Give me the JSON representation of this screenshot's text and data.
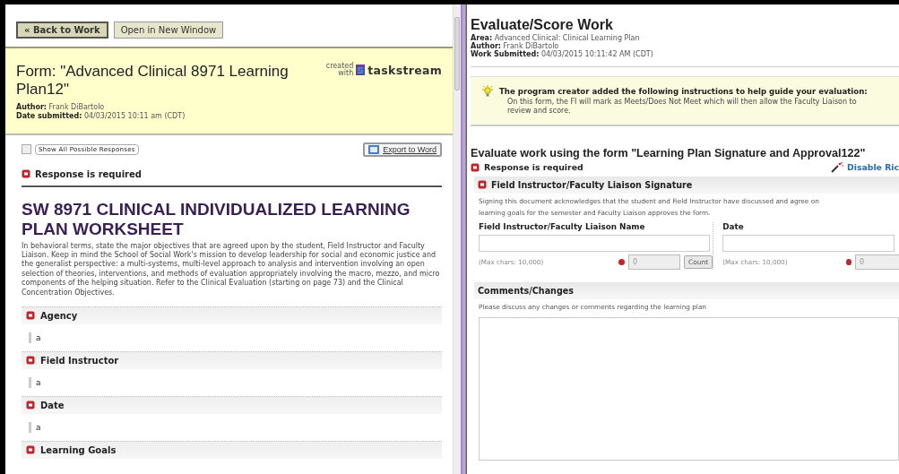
{
  "left": {
    "buttons": [
      {
        "label": "« Back to Work",
        "kind": "primary"
      },
      {
        "label": "Open in New Window",
        "kind": "secondary"
      }
    ],
    "form_header": {
      "title_label": "Form:",
      "title": "\"Advanced Clinical 8971 Learning Plan12\"",
      "created_with": "created with",
      "brand": "taskstream",
      "meta": [
        {
          "label": "Author:",
          "value": "Frank DiBartolo"
        },
        {
          "label": "Date submitted:",
          "value": "04/03/2015 10:11 am (CDT)"
        }
      ]
    },
    "show_all": {
      "label": "Show All Possible Responses",
      "checked": false
    },
    "export_button": "Export to Word",
    "required_note": "Response is required",
    "worksheet_title": "SW 8971 CLINICAL INDIVIDUALIZED LEARNING PLAN WORKSHEET",
    "intro": "In behavioral terms, state the major objectives that are agreed upon by the student, Field Instructor and Faculty Liaison. Keep in mind the School of Social Work's mission to develop leadership for social and economic justice and the generalist perspective: a multi-systems, multi-level approach to analysis and intervention involving an open selection of theories, interventions, and methods of evaluation appropriately involving the macro, mezzo, and micro components of the helping situation. Refer to the Clinical Evaluation (starting on page 73) and the Clinical Concentration Objectives.",
    "fields": [
      {
        "label": "Agency",
        "required": true,
        "value": "a"
      },
      {
        "label": "Field Instructor",
        "required": true,
        "value": "a"
      },
      {
        "label": "Date",
        "required": true,
        "value": "a"
      },
      {
        "label": "Learning Goals",
        "required": true
      }
    ]
  },
  "right": {
    "title": "Evaluate/Score Work",
    "meta": [
      {
        "label": "Area:",
        "value": "Advanced Clinical: Clinical Learning Plan"
      },
      {
        "label": "Author:",
        "value": "Frank DiBartolo"
      },
      {
        "label": "Work Submitted:",
        "value": "04/03/2015 10:11:42 AM (CDT)"
      }
    ],
    "instructions": {
      "heading": "The program creator added the following instructions to help guide your evaluation:",
      "lines": [
        "On this form, the FI will mark as Meets/Does Not Meet which will then allow the Faculty Liaison to",
        "review and score."
      ]
    },
    "form_title": "Evaluate work using the form \"Learning Plan Signature and Approval122\"",
    "required_note": "Response is required",
    "rich_text_link": "Disable Ric",
    "sections": [
      {
        "kind": "signature",
        "title": "Field Instructor/Faculty Liaison Signature",
        "required": true,
        "description_lines": [
          "Signing this document acknowledges that the student and Field Instructor have discussed and agree on",
          "learning goals for the semester and Faculty Liaison approves the form."
        ],
        "fields": [
          {
            "label": "Field Instructor/Faculty Liaison Name",
            "hint": "(Max chars: 10,000)",
            "count": "0",
            "count_button": "Count"
          },
          {
            "label": "Date",
            "hint": "(Max chars: 10,000)",
            "count": "0"
          }
        ]
      },
      {
        "kind": "comments",
        "title": "Comments/Changes",
        "required": false,
        "description_lines": [
          "Please discuss any changes or comments regarding the learning plan"
        ]
      }
    ]
  }
}
